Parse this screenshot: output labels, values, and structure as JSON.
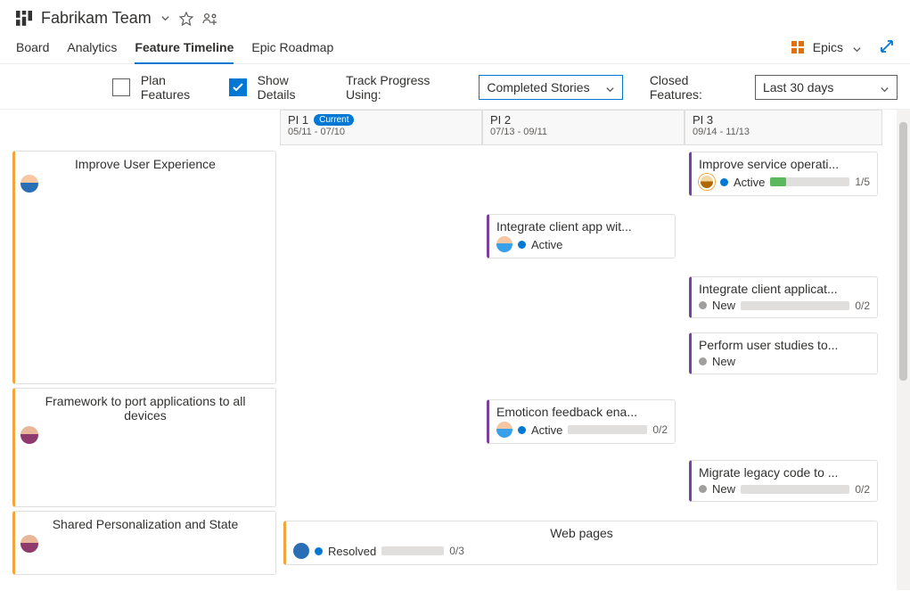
{
  "header": {
    "teamName": "Fabrikam Team"
  },
  "tabs": {
    "board": "Board",
    "analytics": "Analytics",
    "featureTimeline": "Feature Timeline",
    "epicRoadmap": "Epic Roadmap",
    "epicsDropdown": "Epics"
  },
  "controls": {
    "planFeatures": "Plan Features",
    "showDetails": "Show Details",
    "trackProgressLabel": "Track Progress Using:",
    "trackProgressValue": "Completed Stories",
    "closedFeaturesLabel": "Closed Features:",
    "closedFeaturesValue": "Last 30 days"
  },
  "periods": {
    "pi1": {
      "name": "PI 1",
      "badge": "Current",
      "dates": "05/11 - 07/10"
    },
    "pi2": {
      "name": "PI 2",
      "dates": "07/13 - 09/11"
    },
    "pi3": {
      "name": "PI 3",
      "dates": "09/14 - 11/13"
    }
  },
  "epics": [
    {
      "title": "Improve User Experience"
    },
    {
      "title": "Framework to port applications to all devices"
    },
    {
      "title": "Shared Personalization and State"
    }
  ],
  "features": {
    "improveService": {
      "title": "Improve service operati...",
      "status": "Active",
      "progressText": "1/5",
      "progressPct": 20
    },
    "integrateClientApp": {
      "title": "Integrate client app wit...",
      "status": "Active"
    },
    "integrateClientApplicat": {
      "title": "Integrate client applicat...",
      "status": "New",
      "progressText": "0/2"
    },
    "performUserStudies": {
      "title": "Perform user studies to...",
      "status": "New"
    },
    "emoticonFeedback": {
      "title": "Emoticon feedback ena...",
      "status": "Active",
      "progressText": "0/2"
    },
    "migrateLegacy": {
      "title": "Migrate legacy code to ...",
      "status": "New",
      "progressText": "0/2"
    },
    "webPages": {
      "title": "Web pages",
      "status": "Resolved",
      "progressText": "0/3"
    }
  }
}
